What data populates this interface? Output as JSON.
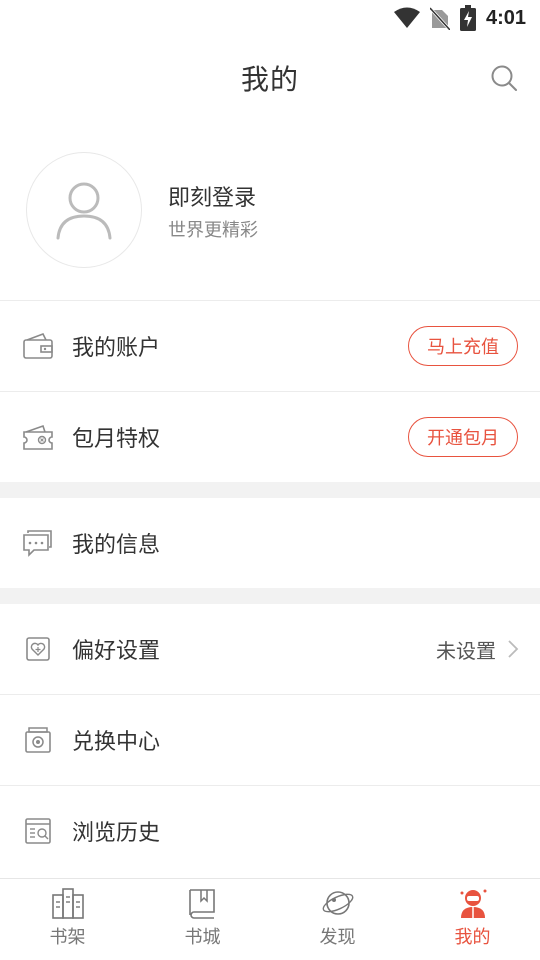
{
  "status_bar": {
    "time": "4:01"
  },
  "header": {
    "title": "我的"
  },
  "profile": {
    "login_label": "即刻登录",
    "subtitle": "世界更精彩"
  },
  "menu": {
    "account": {
      "label": "我的账户",
      "button": "马上充值"
    },
    "monthly": {
      "label": "包月特权",
      "button": "开通包月"
    },
    "messages": {
      "label": "我的信息"
    },
    "preferences": {
      "label": "偏好设置",
      "value": "未设置"
    },
    "redeem": {
      "label": "兑换中心"
    },
    "history": {
      "label": "浏览历史"
    }
  },
  "tabbar": {
    "tabs": [
      {
        "label": "书架"
      },
      {
        "label": "书城"
      },
      {
        "label": "发现"
      },
      {
        "label": "我的"
      }
    ],
    "active_index": 3
  },
  "colors": {
    "accent": "#e8533f",
    "icon_gray": "#8a8a8a"
  }
}
